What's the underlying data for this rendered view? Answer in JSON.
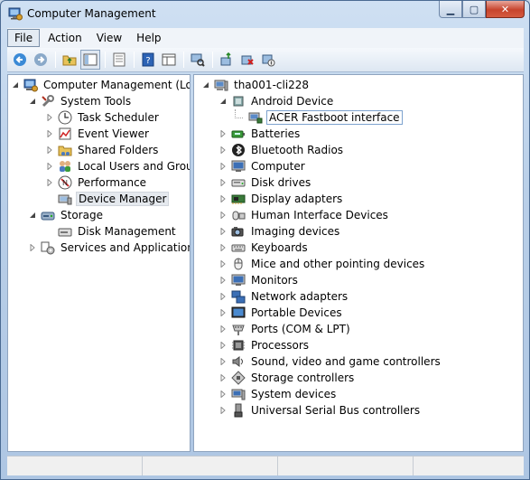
{
  "window": {
    "title": "Computer Management"
  },
  "caption": {
    "minimize": "▁",
    "maximize": "▢",
    "close": "✕"
  },
  "menu": [
    {
      "label": "File",
      "active": true
    },
    {
      "label": "Action",
      "active": false
    },
    {
      "label": "View",
      "active": false
    },
    {
      "label": "Help",
      "active": false
    }
  ],
  "toolbar": [
    "back-icon",
    "forward-icon",
    "sep",
    "up-folder-icon",
    "show-hide-tree-icon",
    "sep",
    "properties-icon",
    "sep",
    "help-icon",
    "view-icon",
    "sep",
    "scan-hardware-icon",
    "sep",
    "update-driver-icon",
    "uninstall-icon",
    "disable-icon"
  ],
  "left_tree": [
    {
      "label": "Computer Management (Local)",
      "level": 0,
      "expander": "open",
      "icon": "computer-management-icon"
    },
    {
      "label": "System Tools",
      "level": 1,
      "expander": "open",
      "icon": "tools-icon"
    },
    {
      "label": "Task Scheduler",
      "level": 2,
      "expander": "closed",
      "icon": "clock-icon"
    },
    {
      "label": "Event Viewer",
      "level": 2,
      "expander": "closed",
      "icon": "event-viewer-icon"
    },
    {
      "label": "Shared Folders",
      "level": 2,
      "expander": "closed",
      "icon": "shared-folders-icon"
    },
    {
      "label": "Local Users and Groups",
      "level": 2,
      "expander": "closed",
      "icon": "users-icon"
    },
    {
      "label": "Performance",
      "level": 2,
      "expander": "closed",
      "icon": "performance-icon"
    },
    {
      "label": "Device Manager",
      "level": 2,
      "expander": "none",
      "icon": "device-manager-icon",
      "selected": true
    },
    {
      "label": "Storage",
      "level": 1,
      "expander": "open",
      "icon": "storage-icon"
    },
    {
      "label": "Disk Management",
      "level": 2,
      "expander": "none",
      "icon": "disk-management-icon"
    },
    {
      "label": "Services and Applications",
      "level": 1,
      "expander": "closed",
      "icon": "services-icon"
    }
  ],
  "right_tree": [
    {
      "label": "tha001-cli228",
      "level": 0,
      "expander": "open",
      "icon": "computer-icon"
    },
    {
      "label": "Android Device",
      "level": 1,
      "expander": "open",
      "icon": "android-device-icon"
    },
    {
      "label": "ACER Fastboot interface",
      "level": 2,
      "expander": "none",
      "icon": "usb-device-icon",
      "focused": true
    },
    {
      "label": "Batteries",
      "level": 1,
      "expander": "closed",
      "icon": "battery-icon"
    },
    {
      "label": "Bluetooth Radios",
      "level": 1,
      "expander": "closed",
      "icon": "bluetooth-icon"
    },
    {
      "label": "Computer",
      "level": 1,
      "expander": "closed",
      "icon": "monitor-icon"
    },
    {
      "label": "Disk drives",
      "level": 1,
      "expander": "closed",
      "icon": "disk-drive-icon"
    },
    {
      "label": "Display adapters",
      "level": 1,
      "expander": "closed",
      "icon": "display-adapter-icon"
    },
    {
      "label": "Human Interface Devices",
      "level": 1,
      "expander": "closed",
      "icon": "hid-icon"
    },
    {
      "label": "Imaging devices",
      "level": 1,
      "expander": "closed",
      "icon": "camera-icon"
    },
    {
      "label": "Keyboards",
      "level": 1,
      "expander": "closed",
      "icon": "keyboard-icon"
    },
    {
      "label": "Mice and other pointing devices",
      "level": 1,
      "expander": "closed",
      "icon": "mouse-icon"
    },
    {
      "label": "Monitors",
      "level": 1,
      "expander": "closed",
      "icon": "monitor-icon"
    },
    {
      "label": "Network adapters",
      "level": 1,
      "expander": "closed",
      "icon": "network-icon"
    },
    {
      "label": "Portable Devices",
      "level": 1,
      "expander": "closed",
      "icon": "portable-device-icon"
    },
    {
      "label": "Ports (COM & LPT)",
      "level": 1,
      "expander": "closed",
      "icon": "port-icon"
    },
    {
      "label": "Processors",
      "level": 1,
      "expander": "closed",
      "icon": "processor-icon"
    },
    {
      "label": "Sound, video and game controllers",
      "level": 1,
      "expander": "closed",
      "icon": "sound-icon"
    },
    {
      "label": "Storage controllers",
      "level": 1,
      "expander": "closed",
      "icon": "storage-controller-icon"
    },
    {
      "label": "System devices",
      "level": 1,
      "expander": "closed",
      "icon": "system-device-icon"
    },
    {
      "label": "Universal Serial Bus controllers",
      "level": 1,
      "expander": "closed",
      "icon": "usb-icon"
    }
  ],
  "colors": {
    "selected_bg": "#e5e9ee",
    "focus_border": "#7da2ce",
    "titlebar": "#b9cfe8"
  }
}
